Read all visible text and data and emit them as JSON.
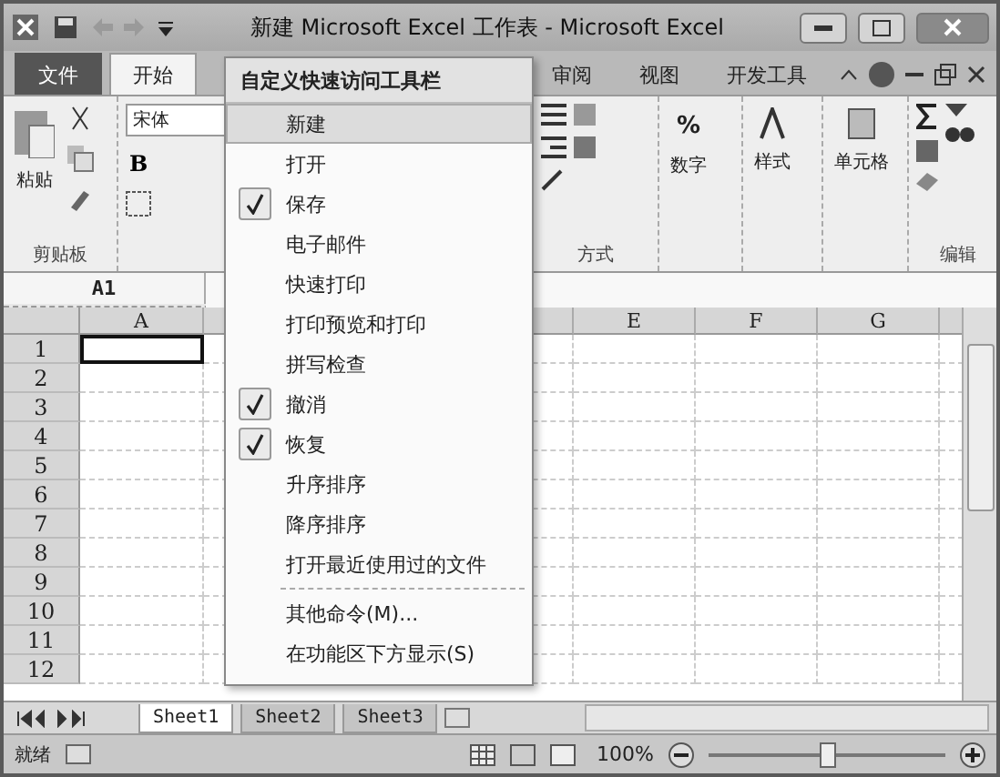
{
  "window": {
    "title": "新建 Microsoft Excel 工作表 - Microsoft Excel"
  },
  "ribbon_tabs": [
    {
      "label": "文件",
      "kind": "file",
      "selected": false
    },
    {
      "label": "开始",
      "kind": "tab",
      "selected": true
    },
    {
      "label": "审阅",
      "kind": "tab",
      "selected": false
    },
    {
      "label": "视图",
      "kind": "tab",
      "selected": false
    },
    {
      "label": "开发工具",
      "kind": "tab",
      "selected": false
    }
  ],
  "ribbon": {
    "paste": "粘贴",
    "clipboard_label": "剪贴板",
    "font_name": "宋体",
    "bold": "B",
    "alignment_label": "方式",
    "number": "数字",
    "percent": "%",
    "styles": "样式",
    "cells": "单元格",
    "editing_label": "编辑"
  },
  "formula_bar": {
    "name_box": "A1"
  },
  "columns": [
    "A",
    "E",
    "F",
    "G"
  ],
  "rows": [
    {
      "label": "1",
      "selected": true
    },
    {
      "label": "2",
      "selected": false
    },
    {
      "label": "3",
      "selected": false
    },
    {
      "label": "4",
      "selected": false
    },
    {
      "label": "5",
      "selected": false
    },
    {
      "label": "6",
      "selected": false
    },
    {
      "label": "7",
      "selected": false
    },
    {
      "label": "8",
      "selected": false
    },
    {
      "label": "9",
      "selected": false
    },
    {
      "label": "10",
      "selected": false
    },
    {
      "label": "11",
      "selected": false
    },
    {
      "label": "12",
      "selected": false
    }
  ],
  "sheet_tabs": [
    {
      "label": "Sheet1",
      "selected": true
    },
    {
      "label": "Sheet2",
      "selected": false
    },
    {
      "label": "Sheet3",
      "selected": false
    }
  ],
  "status_bar": {
    "text": "就绪",
    "zoom": "100%",
    "zoom_slider": {
      "level": 0.5
    }
  },
  "menu": {
    "title": "自定义快速访问工具栏",
    "items": [
      {
        "kind": "item",
        "label": "新建",
        "checked": false,
        "highlighted": true
      },
      {
        "kind": "item",
        "label": "打开",
        "checked": false,
        "highlighted": false
      },
      {
        "kind": "item",
        "label": "保存",
        "checked": true,
        "highlighted": false
      },
      {
        "kind": "item",
        "label": "电子邮件",
        "checked": false,
        "highlighted": false
      },
      {
        "kind": "item",
        "label": "快速打印",
        "checked": false,
        "highlighted": false
      },
      {
        "kind": "item",
        "label": "打印预览和打印",
        "checked": false,
        "highlighted": false
      },
      {
        "kind": "item",
        "label": "拼写检查",
        "checked": false,
        "highlighted": false
      },
      {
        "kind": "item",
        "label": "撤消",
        "checked": true,
        "highlighted": false
      },
      {
        "kind": "item",
        "label": "恢复",
        "checked": true,
        "highlighted": false
      },
      {
        "kind": "item",
        "label": "升序排序",
        "checked": false,
        "highlighted": false
      },
      {
        "kind": "item",
        "label": "降序排序",
        "checked": false,
        "highlighted": false
      },
      {
        "kind": "item",
        "label": "打开最近使用过的文件",
        "checked": false,
        "highlighted": false
      },
      {
        "kind": "separator"
      },
      {
        "kind": "item",
        "label": "其他命令(M)...",
        "checked": false,
        "highlighted": false
      },
      {
        "kind": "item",
        "label": "在功能区下方显示(S)",
        "checked": false,
        "highlighted": false
      }
    ]
  }
}
